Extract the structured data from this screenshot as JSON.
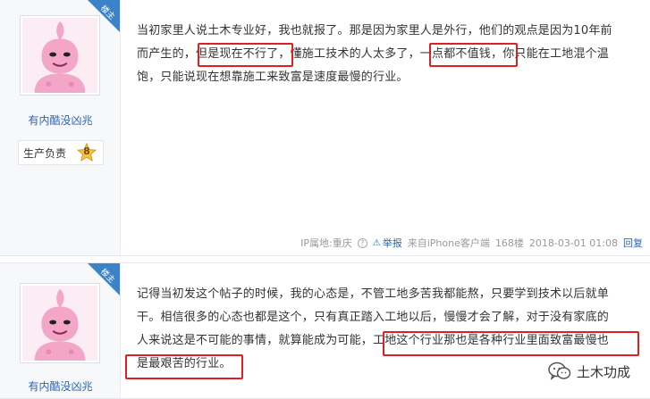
{
  "posts": [
    {
      "ribbon": "楼主",
      "username": "有内酷没凶兆",
      "badge_title": "生产负责",
      "badge_level": "8",
      "lines": [
        "当初家里人说土木专业好，我也就报了。那是因为家里人是外行，他们的观点是因为10年前",
        "而产生的，但是现在不行了，懂施工技术的人太多了，一点都不值钱，你只能在工地混个温",
        "饱，只能说现在想靠施工来致富是速度最慢的行业。"
      ],
      "footer": {
        "ip": "IP属地:重庆",
        "report": "举报",
        "source": "来自iPhone客户端",
        "floor": "168楼",
        "time": "2018-03-01 01:08",
        "reply": "回复"
      }
    },
    {
      "ribbon": "楼主",
      "username": "有内酷没凶兆",
      "lines": [
        "记得当初发这个帖子的时候，我的心态是，不管工地多苦我都能熬，只要学到技术以后就单",
        "干。相信很多的心态也都是这个，只有真正踏入工地以后，慢慢才会了解，对于没有家底的",
        "人来说这是不可能的事情，就算能成为可能，工地这个行业那也是各种行业里面致富最慢也",
        "是最艰苦的行业。"
      ]
    }
  ],
  "watermark": {
    "text": "土木功成",
    "icon": "wechat-icon"
  },
  "colors": {
    "highlight": "#e02020",
    "link": "#2d64b3",
    "ribbon": "#3b82c9"
  }
}
